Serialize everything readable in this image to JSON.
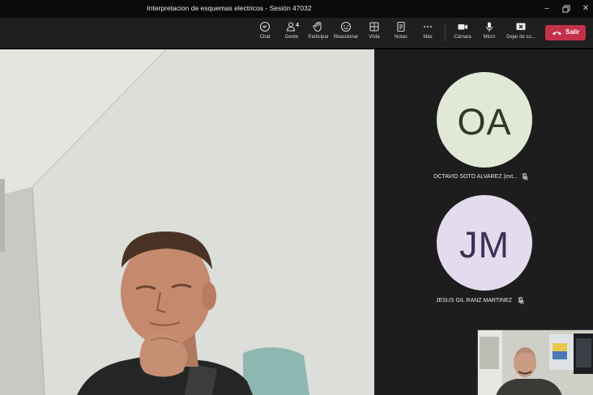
{
  "window": {
    "title": "Interpretacion de esquemas electricos - Sesión 47032"
  },
  "toolbar": {
    "chat": {
      "label": "Chat",
      "icon": "chat-icon"
    },
    "people": {
      "label": "Gente",
      "count": "4",
      "icon": "people-icon"
    },
    "raise": {
      "label": "Participar",
      "icon": "raise-hand-icon"
    },
    "react": {
      "label": "Reaccionar",
      "icon": "smiley-icon"
    },
    "view": {
      "label": "Vista",
      "icon": "view-icon"
    },
    "notes": {
      "label": "Notas",
      "icon": "notes-icon"
    },
    "more": {
      "label": "Más",
      "icon": "ellipsis-icon"
    },
    "camera": {
      "label": "Cámara",
      "icon": "camera-icon"
    },
    "mic": {
      "label": "Micro",
      "icon": "mic-icon"
    },
    "share": {
      "label": "Dejar de co...",
      "icon": "share-stop-icon"
    },
    "leave": {
      "label": "Salir",
      "icon": "hangup-icon",
      "color": "#c4314b"
    }
  },
  "participants": [
    {
      "initials": "OA",
      "name": "OCTAVIO SOTO ALVAREZ (ext...",
      "avatar_bg": "#e2e8d6",
      "initials_color": "#2f3a22",
      "muted": true
    },
    {
      "initials": "JM",
      "name": "JESUS GIL RANZ MARTINEZ",
      "avatar_bg": "#e4dcee",
      "initials_color": "#3d3157",
      "muted": true
    }
  ]
}
